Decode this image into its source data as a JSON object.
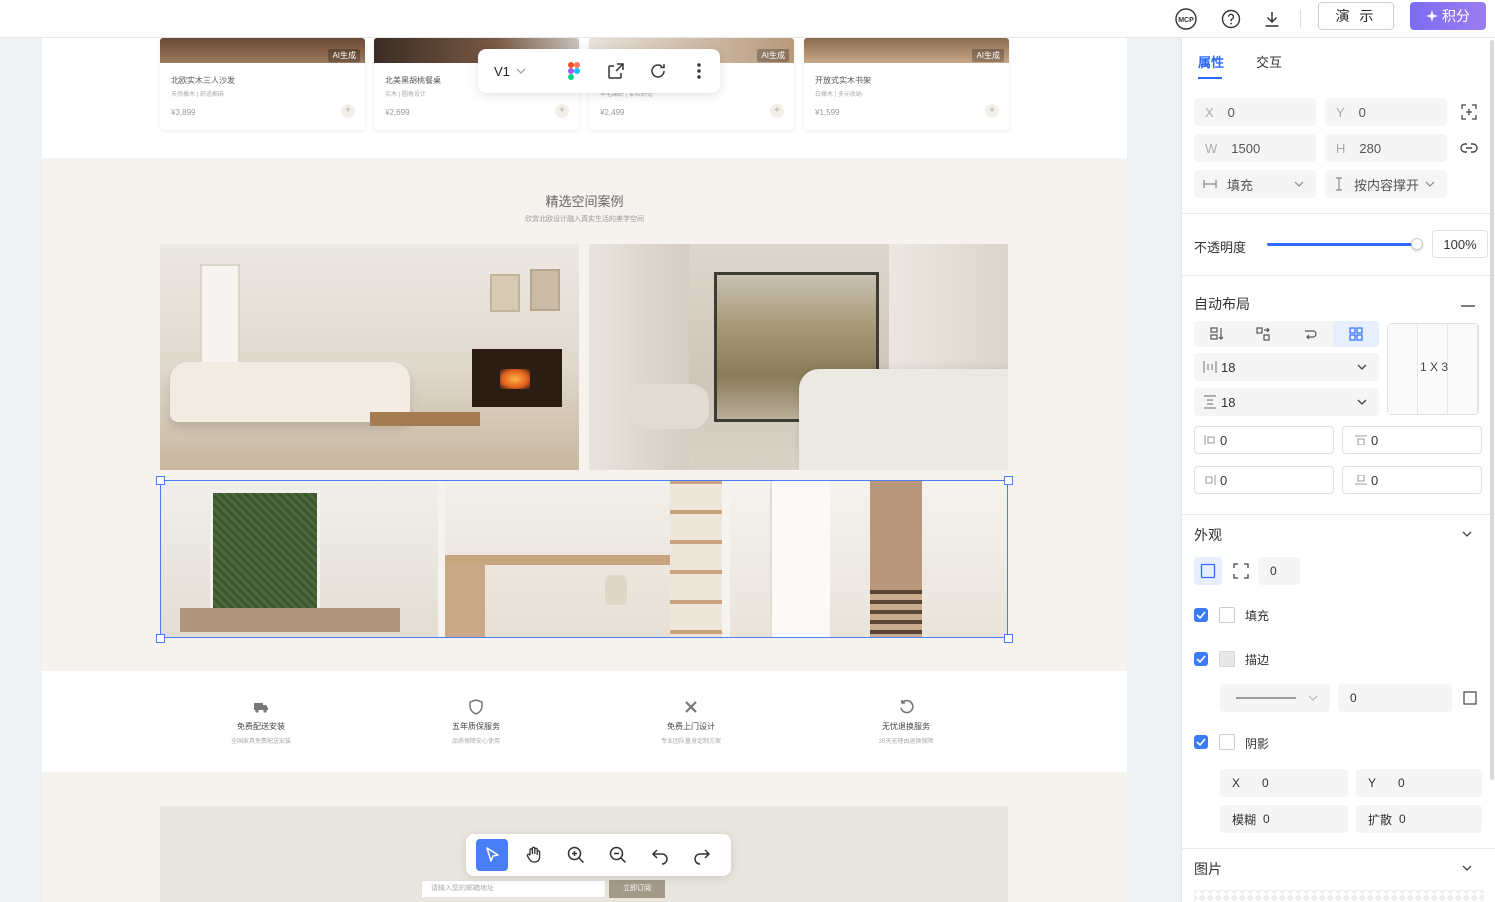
{
  "topbar": {
    "mcp_label": "MCP",
    "present_label": "演 示",
    "points_label": "积分"
  },
  "canvas": {
    "float_bar": {
      "version": "V1"
    },
    "products": [
      {
        "name": "北欧实木三人沙发",
        "desc": "天然橡木 | 舒适棉麻",
        "price": "¥3,899",
        "ai": "AI生成"
      },
      {
        "name": "北美黑胡桃餐桌",
        "desc": "实木 | 圆角设计",
        "price": "¥2,699",
        "ai": "AI生成"
      },
      {
        "name": "",
        "desc": "羊毛编织 | 柔软舒适",
        "price": "¥2,499",
        "ai": "AI生成"
      },
      {
        "name": "开放式实木书架",
        "desc": "白橡木 | 多元收纳",
        "price": "¥1,599",
        "ai": "AI生成"
      }
    ],
    "cases": {
      "title": "精选空间案例",
      "subtitle": "欣赏北欧设计融入真实生活的美学空间"
    },
    "services": [
      {
        "icon": "truck-icon",
        "title": "免费配送安装",
        "desc": "全国家具免费配送安装"
      },
      {
        "icon": "shield-icon",
        "title": "五年质保服务",
        "desc": "品质保障安心使用"
      },
      {
        "icon": "tools-icon",
        "title": "免费上门设计",
        "desc": "专业团队量身定制方案"
      },
      {
        "icon": "return-icon",
        "title": "无忧退换服务",
        "desc": "30天无理由退换保障"
      }
    ],
    "newsletter": {
      "placeholder": "请输入您的邮箱地址",
      "button": "立即订阅"
    }
  },
  "panel": {
    "tabs": [
      "属性",
      "交互"
    ],
    "x": {
      "label": "X",
      "value": "0"
    },
    "y": {
      "label": "Y",
      "value": "0"
    },
    "w": {
      "label": "W",
      "value": "1500"
    },
    "h": {
      "label": "H",
      "value": "280"
    },
    "width_mode": "填充",
    "height_mode": "按内容撑开",
    "opacity": {
      "label": "不透明度",
      "value": "100%",
      "level": 1.0
    },
    "auto_layout": {
      "title": "自动布局",
      "gap_h": "18",
      "gap_v": "18",
      "grid": "1 X 3",
      "pad_left": "0",
      "pad_top": "0",
      "pad_right": "0",
      "pad_bottom": "0"
    },
    "appearance": {
      "title": "外观",
      "radius": "0",
      "fill_label": "填充",
      "stroke_label": "描边",
      "stroke_width": "0",
      "shadow_label": "阴影",
      "shadow_x_label": "X",
      "shadow_x": "0",
      "shadow_y_label": "Y",
      "shadow_y": "0",
      "blur_label": "模糊",
      "blur": "0",
      "spread_label": "扩散",
      "spread": "0"
    },
    "image_title": "图片"
  }
}
